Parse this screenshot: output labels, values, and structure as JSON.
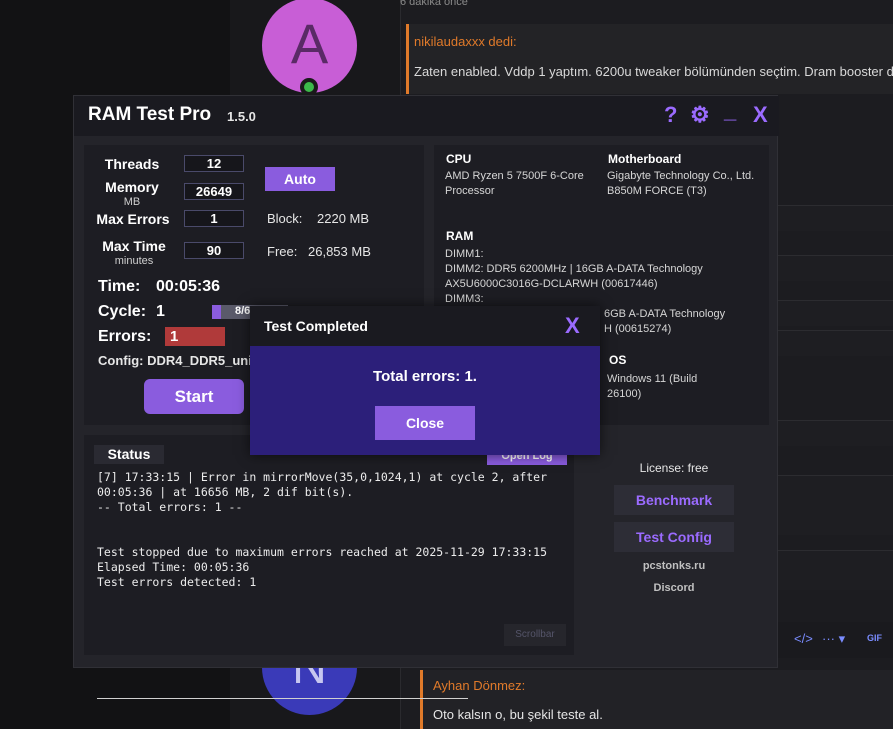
{
  "forum": {
    "time_ago": "6 dakika önce",
    "avatar_a": "A",
    "avatar_n": "N",
    "quote_author": "nikilaudaxxx dedi:",
    "quote_text": "Zaten enabled. Vddp 1 yaptım. 6200u tweaker bölümünden seçtim. Dram booster di",
    "reply_author": "Ayhan Dönmez:",
    "reply_text": "Oto kalsın o, bu şekil teste al.",
    "toolbar_code": "</>",
    "toolbar_more": "··· ▾",
    "toolbar_gif": "GIF"
  },
  "app": {
    "title": "RAM Test Pro",
    "version": "1.5.0",
    "btn_help": "?",
    "btn_settings": "⚙",
    "btn_minimize": "_",
    "btn_close": "X"
  },
  "settings": {
    "threads_label": "Threads",
    "threads_value": "12",
    "memory_label": "Memory",
    "memory_unit": "MB",
    "memory_value": "26649",
    "max_errors_label": "Max Errors",
    "max_errors_value": "1",
    "max_time_label": "Max Time",
    "max_time_unit": "minutes",
    "max_time_value": "90",
    "auto_button": "Auto",
    "block_label": "Block:",
    "block_value": "2220 MB",
    "free_label": "Free:",
    "free_value": "26,853 MB",
    "time_label": "Time:",
    "time_value": "00:05:36",
    "cycle_label": "Cycle:",
    "cycle_value": "1",
    "cycle_progress_text": "8/6",
    "errors_label": "Errors:",
    "errors_value": "1",
    "config_text": "Config: DDR4_DDR5_unive",
    "start_button": "Start"
  },
  "hardware": {
    "cpu_title": "CPU",
    "cpu_value": "AMD Ryzen 5 7500F 6-Core Processor",
    "mb_title": "Motherboard",
    "mb_value": "Gigabyte Technology Co., Ltd. B850M FORCE (T3)",
    "ram_title": "RAM",
    "dimm1": "DIMM1:",
    "dimm2": "DIMM2: DDR5 6200MHz | 16GB A-DATA Technology",
    "dimm2_part": "AX5U6000C3016G-DCLARWH (00617446)",
    "dimm3": "DIMM3:",
    "dimm4_partial": "6GB A-DATA Technology",
    "dimm4_part_partial": "H (00615274)",
    "os_title": "OS",
    "os_value": "Windows 11 (Build 26100)"
  },
  "status": {
    "tab": "Status",
    "log_button_partial": "Open Log",
    "log": "[7] 17:33:15 | Error in mirrorMove(35,0,1024,1) at cycle 2, after\n00:05:36 | at 16656 MB, 2 dif bit(s).\n-- Total errors: 1 --\n\n\nTest stopped due to maximum errors reached at 2025-11-29 17:33:15\nElapsed Time: 00:05:36\nTest errors detected: 1",
    "scrollbar_label": "Scrollbar"
  },
  "side": {
    "license": "License: free",
    "benchmark": "Benchmark",
    "test_config": "Test Config",
    "site": "pcstonks.ru",
    "discord": "Discord"
  },
  "dialog": {
    "title": "Test Completed",
    "close_x": "X",
    "message": "Total errors: 1.",
    "close_button": "Close"
  },
  "colors": {
    "accent": "#8a5cde",
    "error": "#b03a3a",
    "dialog_bg": "#2c1f7a",
    "forum_author": "#e07a2a"
  }
}
